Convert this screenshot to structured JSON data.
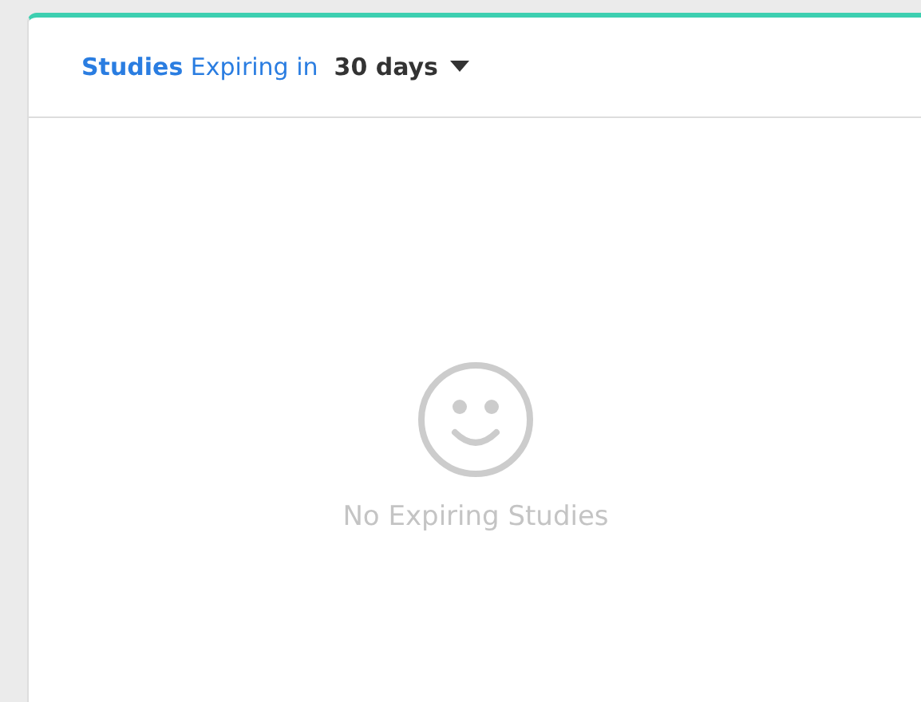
{
  "panel": {
    "title": "**Studies** Expiring in",
    "period_dropdown": {
      "value": "30 days",
      "expanded": false
    }
  },
  "empty_state": {
    "message": "No Expiring Studies"
  }
}
